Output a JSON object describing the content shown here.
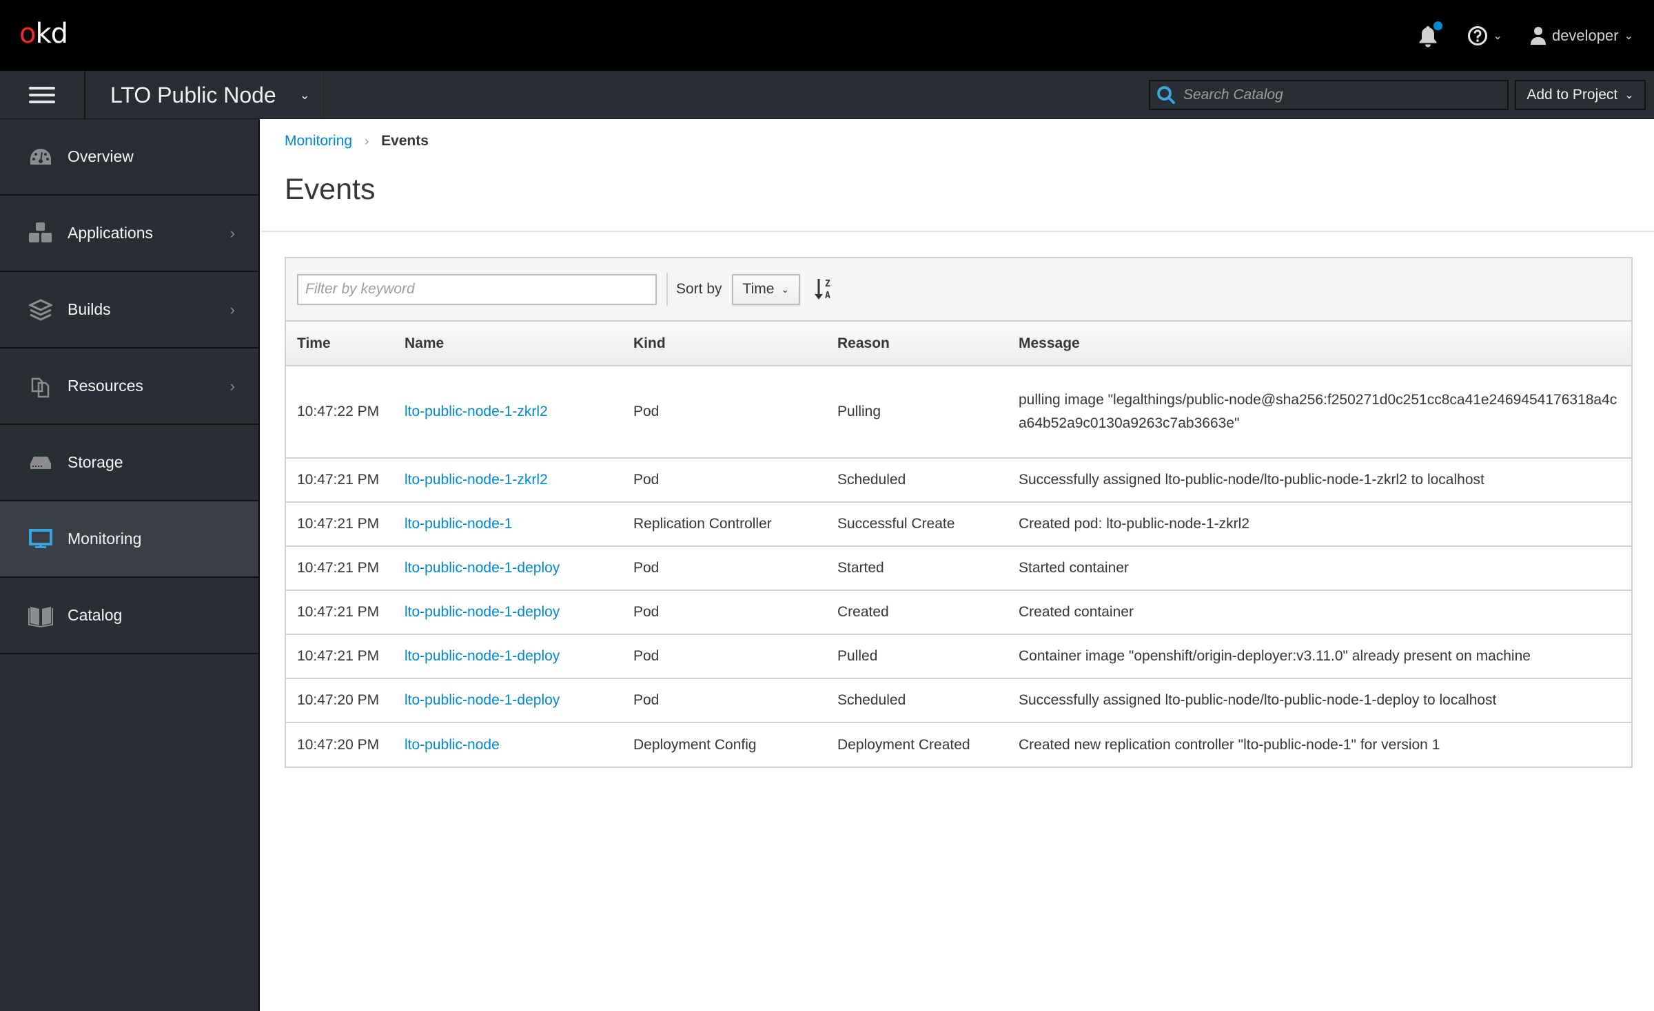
{
  "masthead": {
    "logo_o": "o",
    "logo_rest": "kd",
    "user": "developer"
  },
  "projectbar": {
    "project_name": "LTO Public Node",
    "search_placeholder": "Search Catalog",
    "add_to_project": "Add to Project"
  },
  "sidebar": {
    "items": [
      {
        "label": "Overview",
        "icon": "dashboard-icon",
        "has_submenu": false,
        "active": false
      },
      {
        "label": "Applications",
        "icon": "cubes-icon",
        "has_submenu": true,
        "active": false
      },
      {
        "label": "Builds",
        "icon": "build-layers-icon",
        "has_submenu": true,
        "active": false
      },
      {
        "label": "Resources",
        "icon": "resources-icon",
        "has_submenu": true,
        "active": false
      },
      {
        "label": "Storage",
        "icon": "storage-icon",
        "has_submenu": false,
        "active": false
      },
      {
        "label": "Monitoring",
        "icon": "monitor-icon",
        "has_submenu": false,
        "active": true
      },
      {
        "label": "Catalog",
        "icon": "catalog-book-icon",
        "has_submenu": false,
        "active": false
      }
    ]
  },
  "breadcrumb": {
    "parent": "Monitoring",
    "separator": "›",
    "current": "Events"
  },
  "page": {
    "title": "Events"
  },
  "toolbar": {
    "filter_placeholder": "Filter by keyword",
    "sort_label": "Sort by",
    "sort_value": "Time",
    "sort_direction": "descending"
  },
  "table": {
    "columns": [
      "Time",
      "Name",
      "Kind",
      "Reason",
      "Message"
    ],
    "rows": [
      {
        "time": "10:47:22 PM",
        "name": "lto-public-node-1-zkrl2",
        "kind": "Pod",
        "reason": "Pulling",
        "message": "pulling image \"legalthings/public-node@sha256:f250271d0c251cc8ca41e2469454176318a4ca64b52a9c0130a9263c7ab3663e\""
      },
      {
        "time": "10:47:21 PM",
        "name": "lto-public-node-1-zkrl2",
        "kind": "Pod",
        "reason": "Scheduled",
        "message": "Successfully assigned lto-public-node/lto-public-node-1-zkrl2 to localhost"
      },
      {
        "time": "10:47:21 PM",
        "name": "lto-public-node-1",
        "kind": "Replication Controller",
        "reason": "Successful Create",
        "message": "Created pod: lto-public-node-1-zkrl2"
      },
      {
        "time": "10:47:21 PM",
        "name": "lto-public-node-1-deploy",
        "kind": "Pod",
        "reason": "Started",
        "message": "Started container"
      },
      {
        "time": "10:47:21 PM",
        "name": "lto-public-node-1-deploy",
        "kind": "Pod",
        "reason": "Created",
        "message": "Created container"
      },
      {
        "time": "10:47:21 PM",
        "name": "lto-public-node-1-deploy",
        "kind": "Pod",
        "reason": "Pulled",
        "message": "Container image \"openshift/origin-deployer:v3.11.0\" already present on machine"
      },
      {
        "time": "10:47:20 PM",
        "name": "lto-public-node-1-deploy",
        "kind": "Pod",
        "reason": "Scheduled",
        "message": "Successfully assigned lto-public-node/lto-public-node-1-deploy to localhost"
      },
      {
        "time": "10:47:20 PM",
        "name": "lto-public-node",
        "kind": "Deployment Config",
        "reason": "Deployment Created",
        "message": "Created new replication controller \"lto-public-node-1\" for version 1"
      }
    ]
  },
  "colors": {
    "accent": "#0088ce",
    "logo_red": "#ee2a2a",
    "masthead_bg": "#000000",
    "nav_bg": "#292e34",
    "nav_active_bg": "#393f44",
    "notification_dot": "#0088ce",
    "active_icon": "#39a5dc"
  }
}
